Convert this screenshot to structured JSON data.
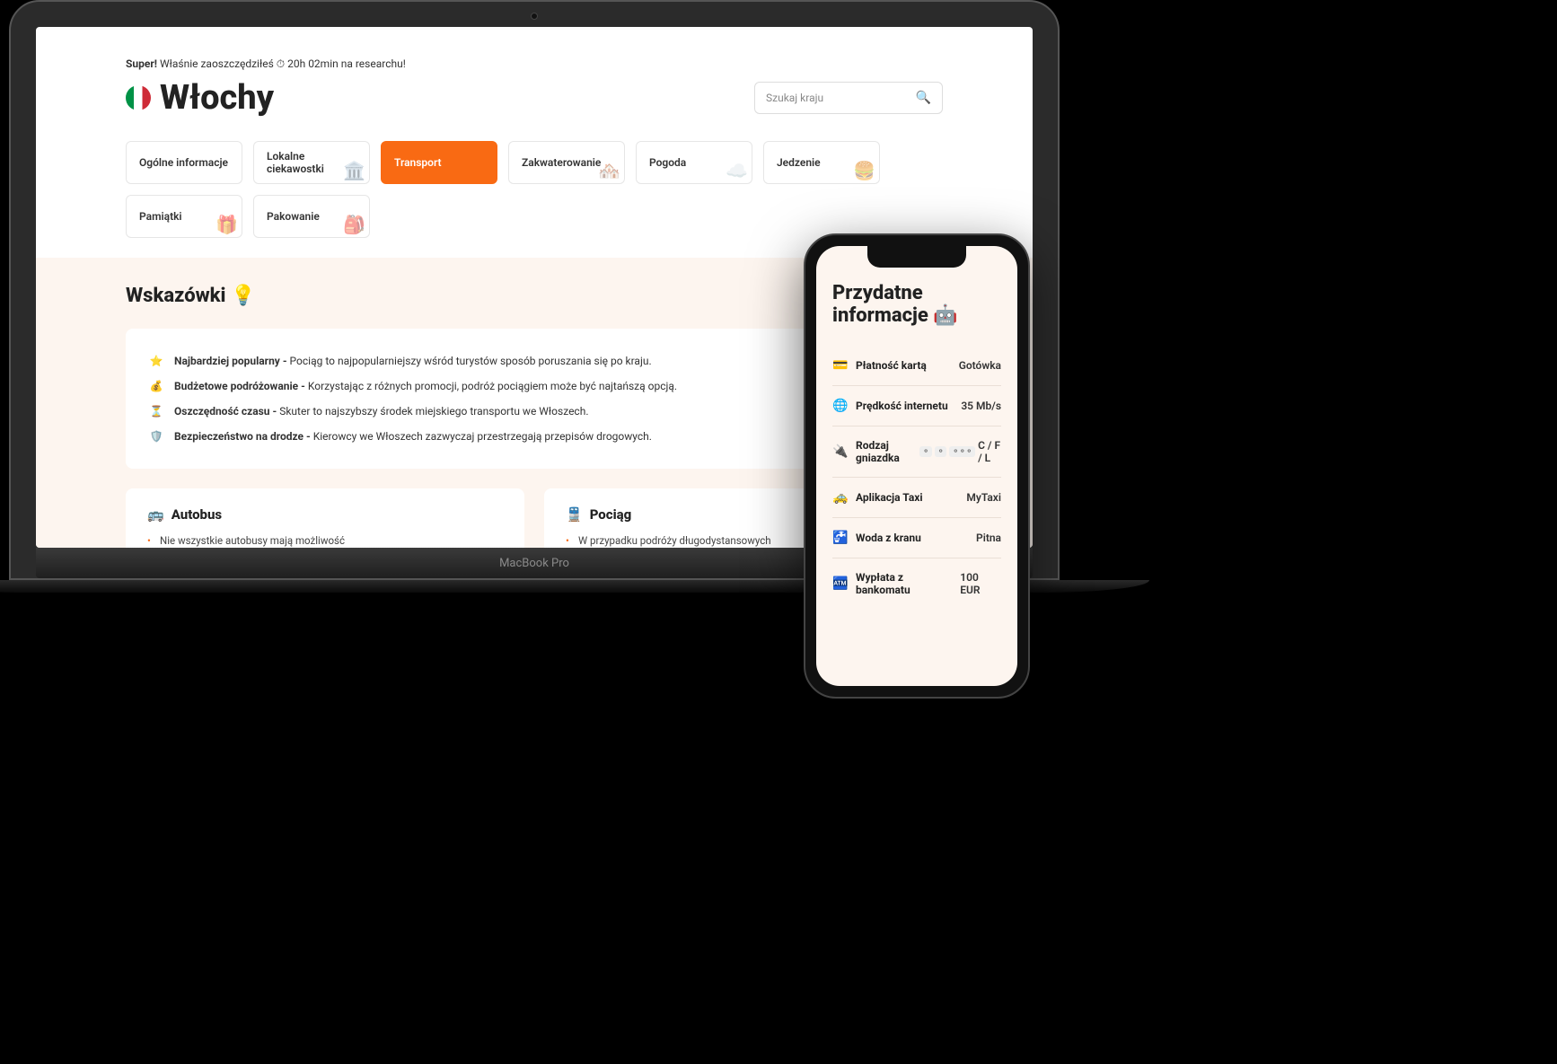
{
  "savings": {
    "prefix": "Super!",
    "text": " Właśnie zaoszczędziłeś ",
    "clock": "⏱",
    "time": " 20h 02min na researchu!"
  },
  "country": {
    "name": "Włochy"
  },
  "search": {
    "placeholder": "Szukaj kraju",
    "icon": "🔍"
  },
  "tabs": [
    {
      "label": "Ogólne informacje",
      "active": false,
      "deco": ""
    },
    {
      "label": "Lokalne ciekawostki",
      "active": false,
      "deco": "🏛️"
    },
    {
      "label": "Transport",
      "active": true,
      "deco": ""
    },
    {
      "label": "Zakwaterowanie",
      "active": false,
      "deco": "🏘️"
    },
    {
      "label": "Pogoda",
      "active": false,
      "deco": "☁️"
    },
    {
      "label": "Jedzenie",
      "active": false,
      "deco": "🍔"
    },
    {
      "label": "Pamiątki",
      "active": false,
      "deco": "🎁"
    },
    {
      "label": "Pakowanie",
      "active": false,
      "deco": "🎒"
    }
  ],
  "tips": {
    "title": "Wskazówki 💡",
    "items": [
      {
        "icon": "⭐",
        "bold": "Najbardziej popularny - ",
        "text": "Pociąg to najpopularniejszy wśród turystów sposób poruszania się po kraju."
      },
      {
        "icon": "💰",
        "bold": "Budżetowe podróżowanie - ",
        "text": "Korzystając z różnych promocji, podróż pociągiem może być najtańszą opcją."
      },
      {
        "icon": "⏳",
        "bold": "Oszczędność czasu - ",
        "text": "Skuter to najszybszy środek miejskiego transportu we Włoszech."
      },
      {
        "icon": "🛡️",
        "bold": "Bezpieczeństwo na drodze - ",
        "text": "Kierowcy we Włoszech zazwyczaj przestrzegają przepisów drogowych."
      }
    ]
  },
  "cards": {
    "bus": {
      "icon": "🚌",
      "title": "Autobus",
      "lines": [
        "Nie wszystkie autobusy mają możliwość"
      ]
    },
    "train": {
      "icon": "🚆",
      "title": "Pociąg",
      "lines": [
        "W przypadku podróży długodystansowych"
      ]
    }
  },
  "laptop_label": "MacBook Pro",
  "phone": {
    "title": "Przydatne informacje 🤖",
    "rows": [
      {
        "icon": "💳",
        "label": "Płatność kartą",
        "value": "Gotówka"
      },
      {
        "icon": "🌐",
        "label": "Prędkość internetu",
        "value": "35 Mb/s"
      },
      {
        "icon": "🔌",
        "label": "Rodzaj gniazdka",
        "value": "C / F / L",
        "sockets": true
      },
      {
        "icon": "🚕",
        "label": "Aplikacja Taxi",
        "value": "MyTaxi"
      },
      {
        "icon": "🚰",
        "label": "Woda z kranu",
        "value": "Pitna"
      },
      {
        "icon": "🏧",
        "label": "Wypłata z bankomatu",
        "value": "100 EUR"
      }
    ]
  }
}
